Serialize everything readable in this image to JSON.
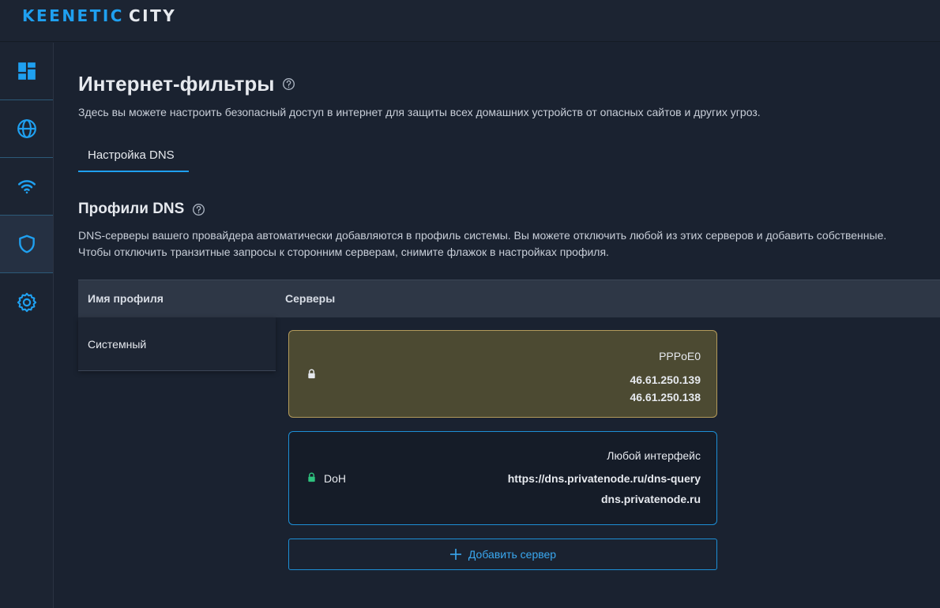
{
  "app": {
    "brand": "KEENETIC",
    "model": "CITY"
  },
  "sidebar": {
    "items": [
      {
        "icon": "dashboard-icon"
      },
      {
        "icon": "globe-icon"
      },
      {
        "icon": "wifi-icon"
      },
      {
        "icon": "shield-icon",
        "active": true
      },
      {
        "icon": "gear-icon"
      }
    ]
  },
  "page": {
    "title": "Интернет-фильтры",
    "description": "Здесь вы можете настроить безопасный доступ в интернет для защиты всех домашних устройств от опасных сайтов и других угроз."
  },
  "tabs": [
    {
      "label": "Настройка DNS",
      "active": true
    }
  ],
  "dns_profiles": {
    "title": "Профили DNS",
    "description_line1": "DNS-серверы вашего провайдера автоматически добавляются в профиль системы. Вы можете отключить любой из этих серверов и добавить собственные.",
    "description_line2": "Чтобы отключить транзитные запросы к сторонним серверам, снимите флажок в настройках профиля.",
    "columns": {
      "name": "Имя профиля",
      "servers": "Серверы"
    },
    "profiles": [
      {
        "name": "Системный"
      }
    ],
    "servers": [
      {
        "type": "system",
        "label": "",
        "interface": "PPPoE0",
        "addresses": [
          "46.61.250.139",
          "46.61.250.138"
        ]
      },
      {
        "type": "doh",
        "label": "DoH",
        "interface": "Любой интерфейс",
        "addresses": [
          "https://dns.privatenode.ru/dns-query",
          "dns.privatenode.ru"
        ]
      }
    ],
    "add_server_label": "Добавить сервер"
  },
  "colors": {
    "accent": "#1fa0f0",
    "background": "#1a2230",
    "system_card": "#4c4a32",
    "system_card_border": "#b39a5a",
    "doh_lock": "#2ec27e"
  }
}
